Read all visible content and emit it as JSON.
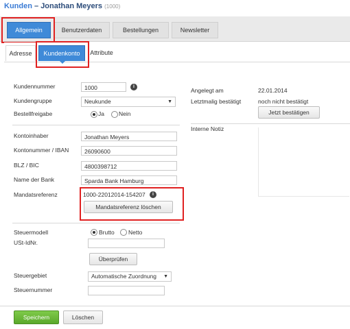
{
  "header": {
    "crumb": "Kunden",
    "sep": " – ",
    "name": "Jonathan Meyers",
    "id": "(1000)"
  },
  "tabs": [
    "Allgemein",
    "Benutzerdaten",
    "Bestellungen",
    "Newsletter"
  ],
  "subtabs": [
    "Adresse",
    "Kundenkonto",
    "Attribute"
  ],
  "form": {
    "kundennummer_label": "Kundennummer",
    "kundennummer_value": "1000",
    "kundengruppe_label": "Kundengruppe",
    "kundengruppe_value": "Neukunde",
    "bestellfreigabe_label": "Bestellfreigabe",
    "bestellfreigabe_ja": "Ja",
    "bestellfreigabe_nein": "Nein",
    "kontoinhaber_label": "Kontoinhaber",
    "kontoinhaber_value": "Jonathan Meyers",
    "iban_label": "Kontonummer / IBAN",
    "iban_value": "26090600",
    "bic_label": "BLZ / BIC",
    "bic_value": "4800398712",
    "bank_label": "Name der Bank",
    "bank_value": "Sparda Bank Hamburg",
    "mandat_label": "Mandatsreferenz",
    "mandat_value": "1000-22012014-154207",
    "mandat_button": "Mandatsreferenz löschen",
    "steuermodell_label": "Steuermodell",
    "brutto": "Brutto",
    "netto": "Netto",
    "ustid_label": "USt-IdNr.",
    "ueberpruefen_button": "Überprüfen",
    "steuergebiet_label": "Steuergebiet",
    "steuergebiet_value": "Automatische Zuordnung",
    "steuernummer_label": "Steuernummer"
  },
  "right": {
    "angelegt_label": "Angelegt am",
    "angelegt_value": "22.01.2014",
    "bestaetigt_label": "Letztmalig bestätigt",
    "bestaetigt_value": "noch nicht bestätigt",
    "confirm_button": "Jetzt bestätigen",
    "notiz_label": "Interne Notiz"
  },
  "footer": {
    "save": "Speichern",
    "delete": "Löschen"
  },
  "colors": {
    "accent": "#3f8ad8",
    "highlight": "#e02020",
    "save": "#5aa82b"
  }
}
